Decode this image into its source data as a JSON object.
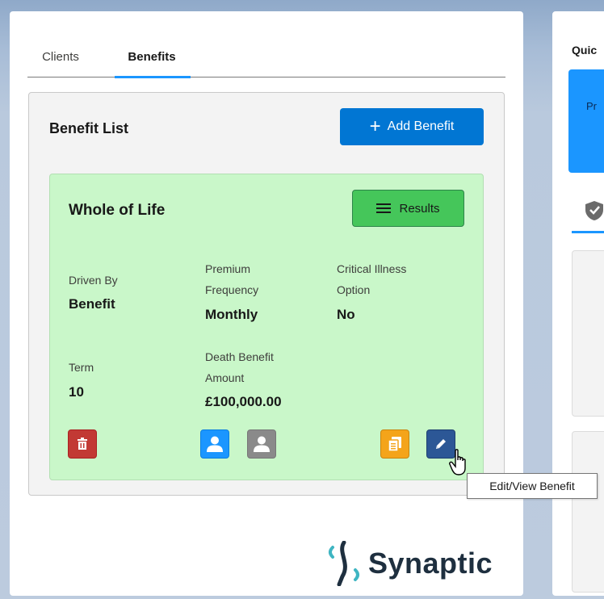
{
  "tabs": [
    {
      "label": "Clients",
      "active": false
    },
    {
      "label": "Benefits",
      "active": true
    }
  ],
  "benefit_list": {
    "title": "Benefit List",
    "add_button_label": "Add Benefit"
  },
  "card": {
    "title": "Whole of Life",
    "results_label": "Results",
    "background_color": "#c9f7c9",
    "fields": {
      "driven_by": {
        "label": "Driven By",
        "value": "Benefit"
      },
      "premium_frequency": {
        "label_line1": "Premium",
        "label_line2": "Frequency",
        "value": "Monthly"
      },
      "critical_illness": {
        "label_line1": "Critical Illness",
        "label_line2": "Option",
        "value": "No"
      },
      "term": {
        "label": "Term",
        "value": "10"
      },
      "death_benefit": {
        "label_line1": "Death Benefit",
        "label_line2": "Amount",
        "value": "£100,000.00"
      }
    }
  },
  "tooltip": "Edit/View Benefit",
  "logo_text": "Synaptic",
  "right_panel": {
    "quick_label": "Quic",
    "blue_box_text": "Pr"
  },
  "colors": {
    "primary": "#0176d3",
    "success": "#45c65a",
    "danger": "#c23934",
    "warning": "#f4a41a",
    "edit": "#2c5796",
    "person_active": "#1b96ff",
    "person_inactive": "#8a8a8a"
  },
  "icons": [
    "plus-icon",
    "list-icon",
    "trash-icon",
    "person-icon",
    "copy-icon",
    "pencil-icon",
    "hand-cursor-icon",
    "shield-icon"
  ]
}
